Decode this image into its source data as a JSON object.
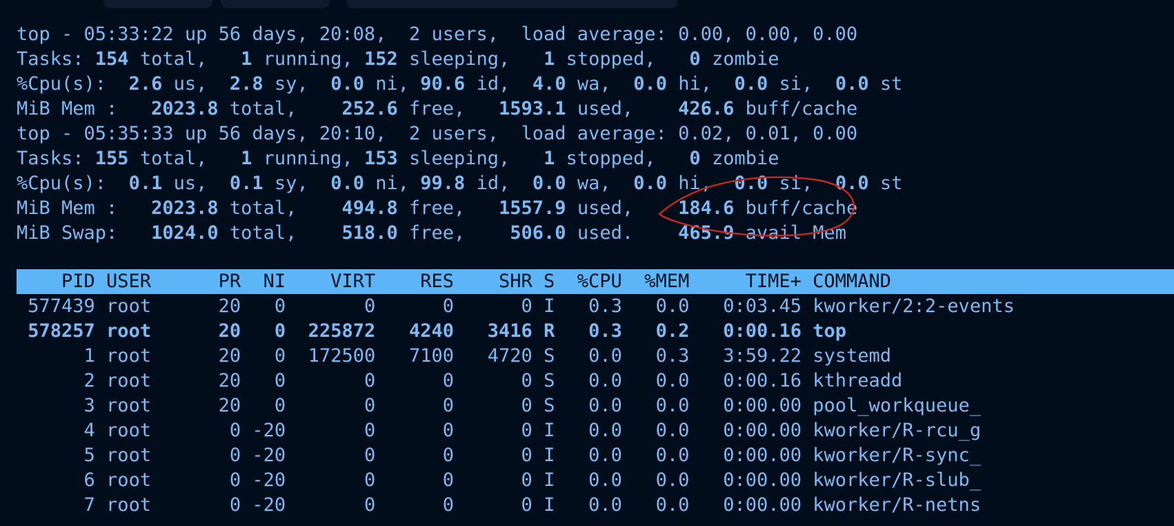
{
  "annotation_color": "#c8281f",
  "header_bg": "#5db5f8",
  "summary_lines": [
    [
      [
        "top - 05:33:22 up 56 days, 20:08,  2 users,  load average: 0.00, 0.00, 0.00",
        false
      ]
    ],
    [
      [
        "Tasks: ",
        false
      ],
      [
        "154",
        true
      ],
      [
        " total,   ",
        false
      ],
      [
        "1",
        true
      ],
      [
        " running, ",
        false
      ],
      [
        "152",
        true
      ],
      [
        " sleeping,   ",
        false
      ],
      [
        "1",
        true
      ],
      [
        " stopped,   ",
        false
      ],
      [
        "0",
        true
      ],
      [
        " zombie",
        false
      ]
    ],
    [
      [
        "%Cpu(s):  ",
        false
      ],
      [
        "2.6",
        true
      ],
      [
        " us,  ",
        false
      ],
      [
        "2.8",
        true
      ],
      [
        " sy,  ",
        false
      ],
      [
        "0.0",
        true
      ],
      [
        " ni, ",
        false
      ],
      [
        "90.6",
        true
      ],
      [
        " id,  ",
        false
      ],
      [
        "4.0",
        true
      ],
      [
        " wa,  ",
        false
      ],
      [
        "0.0",
        true
      ],
      [
        " hi,  ",
        false
      ],
      [
        "0.0",
        true
      ],
      [
        " si,  ",
        false
      ],
      [
        "0.0",
        true
      ],
      [
        " st",
        false
      ]
    ],
    [
      [
        "MiB Mem :   ",
        false
      ],
      [
        "2023.8",
        true
      ],
      [
        " total,    ",
        false
      ],
      [
        "252.6",
        true
      ],
      [
        " free,   ",
        false
      ],
      [
        "1593.1",
        true
      ],
      [
        " used,    ",
        false
      ],
      [
        "426.6",
        true
      ],
      [
        " buff/cache",
        false
      ]
    ],
    [
      [
        "top - 05:35:33 up 56 days, 20:10,  2 users,  load average: 0.02, 0.01, 0.00",
        false
      ]
    ],
    [
      [
        "Tasks: ",
        false
      ],
      [
        "155",
        true
      ],
      [
        " total,   ",
        false
      ],
      [
        "1",
        true
      ],
      [
        " running, ",
        false
      ],
      [
        "153",
        true
      ],
      [
        " sleeping,   ",
        false
      ],
      [
        "1",
        true
      ],
      [
        " stopped,   ",
        false
      ],
      [
        "0",
        true
      ],
      [
        " zombie",
        false
      ]
    ],
    [
      [
        "%Cpu(s):  ",
        false
      ],
      [
        "0.1",
        true
      ],
      [
        " us,  ",
        false
      ],
      [
        "0.1",
        true
      ],
      [
        " sy,  ",
        false
      ],
      [
        "0.0",
        true
      ],
      [
        " ni, ",
        false
      ],
      [
        "99.8",
        true
      ],
      [
        " id,  ",
        false
      ],
      [
        "0.0",
        true
      ],
      [
        " wa,  ",
        false
      ],
      [
        "0.0",
        true
      ],
      [
        " hi,  ",
        false
      ],
      [
        "0.0",
        true
      ],
      [
        " si,  ",
        false
      ],
      [
        "0.0",
        true
      ],
      [
        " st",
        false
      ]
    ],
    [
      [
        "MiB Mem :   ",
        false
      ],
      [
        "2023.8",
        true
      ],
      [
        " total,    ",
        false
      ],
      [
        "494.8",
        true
      ],
      [
        " free,   ",
        false
      ],
      [
        "1557.9",
        true
      ],
      [
        " used,    ",
        false
      ],
      [
        "184.6",
        true
      ],
      [
        " buff/cache",
        false
      ]
    ],
    [
      [
        "MiB Swap:   ",
        false
      ],
      [
        "1024.0",
        true
      ],
      [
        " total,    ",
        false
      ],
      [
        "518.0",
        true
      ],
      [
        " free,    ",
        false
      ],
      [
        "506.0",
        true
      ],
      [
        " used.    ",
        false
      ],
      [
        "465.9",
        true
      ],
      [
        " avail Mem",
        false
      ]
    ]
  ],
  "table_header": "    PID USER      PR  NI    VIRT    RES    SHR S  %CPU  %MEM     TIME+ COMMAND",
  "processes": [
    {
      "pid": "577439",
      "user": "root",
      "pr": "20",
      "ni": "0",
      "virt": "0",
      "res": "0",
      "shr": "0",
      "s": "I",
      "cpu": "0.3",
      "mem": "0.0",
      "time": "0:03.45",
      "command": "kworker/2:2-events",
      "bold": false
    },
    {
      "pid": "578257",
      "user": "root",
      "pr": "20",
      "ni": "0",
      "virt": "225872",
      "res": "4240",
      "shr": "3416",
      "s": "R",
      "cpu": "0.3",
      "mem": "0.2",
      "time": "0:00.16",
      "command": "top",
      "bold": true
    },
    {
      "pid": "1",
      "user": "root",
      "pr": "20",
      "ni": "0",
      "virt": "172500",
      "res": "7100",
      "shr": "4720",
      "s": "S",
      "cpu": "0.0",
      "mem": "0.3",
      "time": "3:59.22",
      "command": "systemd",
      "bold": false
    },
    {
      "pid": "2",
      "user": "root",
      "pr": "20",
      "ni": "0",
      "virt": "0",
      "res": "0",
      "shr": "0",
      "s": "S",
      "cpu": "0.0",
      "mem": "0.0",
      "time": "0:00.16",
      "command": "kthreadd",
      "bold": false
    },
    {
      "pid": "3",
      "user": "root",
      "pr": "20",
      "ni": "0",
      "virt": "0",
      "res": "0",
      "shr": "0",
      "s": "S",
      "cpu": "0.0",
      "mem": "0.0",
      "time": "0:00.00",
      "command": "pool_workqueue_",
      "bold": false
    },
    {
      "pid": "4",
      "user": "root",
      "pr": "0",
      "ni": "-20",
      "virt": "0",
      "res": "0",
      "shr": "0",
      "s": "I",
      "cpu": "0.0",
      "mem": "0.0",
      "time": "0:00.00",
      "command": "kworker/R-rcu_g",
      "bold": false
    },
    {
      "pid": "5",
      "user": "root",
      "pr": "0",
      "ni": "-20",
      "virt": "0",
      "res": "0",
      "shr": "0",
      "s": "I",
      "cpu": "0.0",
      "mem": "0.0",
      "time": "0:00.00",
      "command": "kworker/R-sync_",
      "bold": false
    },
    {
      "pid": "6",
      "user": "root",
      "pr": "0",
      "ni": "-20",
      "virt": "0",
      "res": "0",
      "shr": "0",
      "s": "I",
      "cpu": "0.0",
      "mem": "0.0",
      "time": "0:00.00",
      "command": "kworker/R-slub_",
      "bold": false
    },
    {
      "pid": "7",
      "user": "root",
      "pr": "0",
      "ni": "-20",
      "virt": "0",
      "res": "0",
      "shr": "0",
      "s": "I",
      "cpu": "0.0",
      "mem": "0.0",
      "time": "0:00.00",
      "command": "kworker/R-netns",
      "bold": false
    }
  ]
}
